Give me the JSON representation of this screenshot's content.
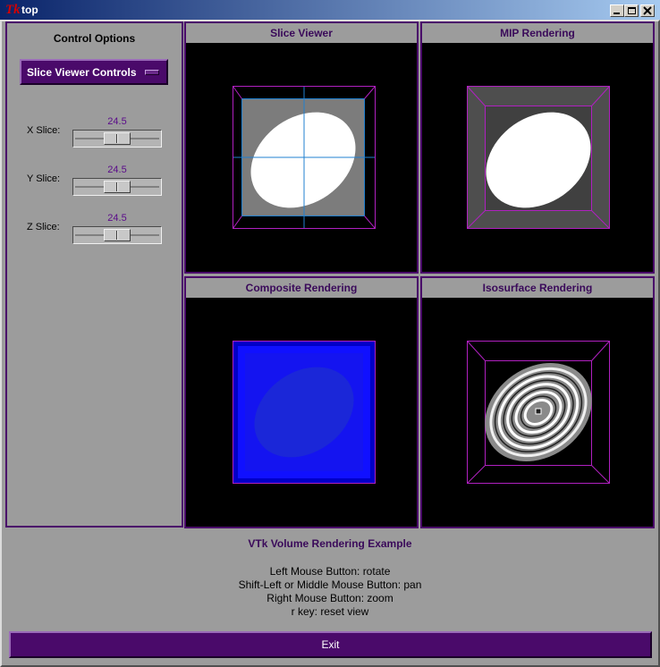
{
  "window": {
    "title": "top",
    "app_icon_glyph": "Tk",
    "buttons": [
      "minimize-icon",
      "maximize-icon",
      "close-icon"
    ]
  },
  "control_panel": {
    "title": "Control Options",
    "menu_label": "Slice Viewer Controls",
    "sliders": [
      {
        "label": "X Slice:",
        "value": "24.5",
        "fraction": 0.5
      },
      {
        "label": "Y Slice:",
        "value": "24.5",
        "fraction": 0.5
      },
      {
        "label": "Z Slice:",
        "value": "24.5",
        "fraction": 0.5
      }
    ]
  },
  "views": {
    "slice": {
      "title": "Slice Viewer"
    },
    "mip": {
      "title": "MIP Rendering"
    },
    "composite": {
      "title": "Composite Rendering"
    },
    "isosurface": {
      "title": "Isosurface Rendering"
    }
  },
  "info": {
    "title": "VTk Volume Rendering Example",
    "lines": [
      "Left Mouse Button: rotate",
      "Shift-Left or Middle Mouse Button: pan",
      "Right Mouse Button: zoom",
      "r key: reset view"
    ]
  },
  "exit_label": "Exit",
  "colors": {
    "accent": "#4a0a6a",
    "background": "#9c9c9c",
    "title_text": "#3a0a5a",
    "slider_value": "#5a0a8a",
    "outline": "#b020c0",
    "slice_crosshair": "#2080d0",
    "composite_blue": "#1010ff"
  }
}
